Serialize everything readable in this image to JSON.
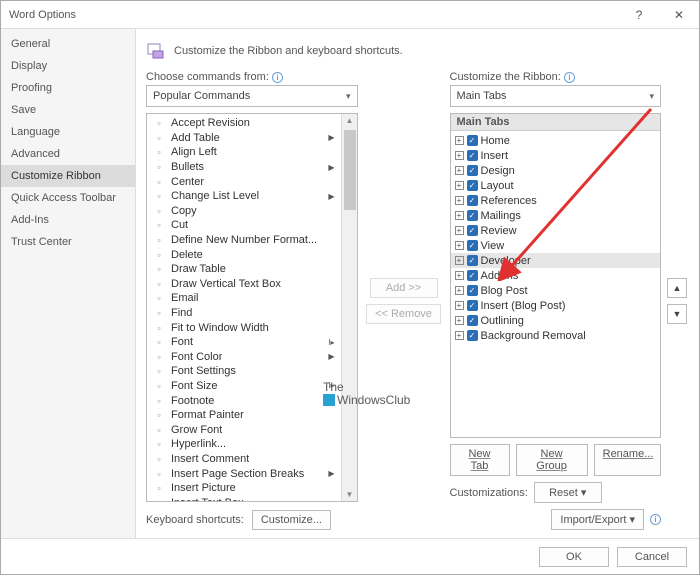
{
  "window": {
    "title": "Word Options"
  },
  "sidebar": {
    "items": [
      {
        "label": "General"
      },
      {
        "label": "Display"
      },
      {
        "label": "Proofing"
      },
      {
        "label": "Save"
      },
      {
        "label": "Language"
      },
      {
        "label": "Advanced"
      },
      {
        "label": "Customize Ribbon"
      },
      {
        "label": "Quick Access Toolbar"
      },
      {
        "label": "Add-Ins"
      },
      {
        "label": "Trust Center"
      }
    ],
    "selected_index": 6
  },
  "heading": "Customize the Ribbon and keyboard shortcuts.",
  "left": {
    "label": "Choose commands from:",
    "combo": "Popular Commands",
    "commands": [
      {
        "label": "Accept Revision"
      },
      {
        "label": "Add Table",
        "submenu": true
      },
      {
        "label": "Align Left"
      },
      {
        "label": "Bullets",
        "submenu": true
      },
      {
        "label": "Center"
      },
      {
        "label": "Change List Level",
        "submenu": true
      },
      {
        "label": "Copy"
      },
      {
        "label": "Cut"
      },
      {
        "label": "Define New Number Format..."
      },
      {
        "label": "Delete"
      },
      {
        "label": "Draw Table"
      },
      {
        "label": "Draw Vertical Text Box"
      },
      {
        "label": "Email"
      },
      {
        "label": "Find"
      },
      {
        "label": "Fit to Window Width"
      },
      {
        "label": "Font",
        "ext": true
      },
      {
        "label": "Font Color",
        "submenu": true
      },
      {
        "label": "Font Settings"
      },
      {
        "label": "Font Size",
        "ext": true
      },
      {
        "label": "Footnote"
      },
      {
        "label": "Format Painter"
      },
      {
        "label": "Grow Font"
      },
      {
        "label": "Hyperlink..."
      },
      {
        "label": "Insert Comment"
      },
      {
        "label": "Insert Page  Section Breaks",
        "submenu": true
      },
      {
        "label": "Insert Picture"
      },
      {
        "label": "Insert Text Box"
      }
    ]
  },
  "mid": {
    "add": "Add >>",
    "remove": "<< Remove"
  },
  "right": {
    "label": "Customize the Ribbon:",
    "combo": "Main Tabs",
    "group_header": "Main Tabs",
    "tabs": [
      {
        "label": "Home"
      },
      {
        "label": "Insert"
      },
      {
        "label": "Design"
      },
      {
        "label": "Layout"
      },
      {
        "label": "References"
      },
      {
        "label": "Mailings"
      },
      {
        "label": "Review"
      },
      {
        "label": "View"
      },
      {
        "label": "Developer",
        "selected": true
      },
      {
        "label": "Add-Ins"
      },
      {
        "label": "Blog Post"
      },
      {
        "label": "Insert (Blog Post)"
      },
      {
        "label": "Outlining"
      },
      {
        "label": "Background Removal"
      }
    ],
    "buttons": {
      "new_tab": "New Tab",
      "new_group": "New Group",
      "rename": "Rename..."
    },
    "customizations_label": "Customizations:",
    "reset": "Reset ▾",
    "import_export": "Import/Export ▾"
  },
  "keyboard": {
    "label": "Keyboard shortcuts:",
    "button": "Customize..."
  },
  "footer": {
    "ok": "OK",
    "cancel": "Cancel"
  },
  "watermark": {
    "line1": "The",
    "line2": "WindowsClub"
  }
}
